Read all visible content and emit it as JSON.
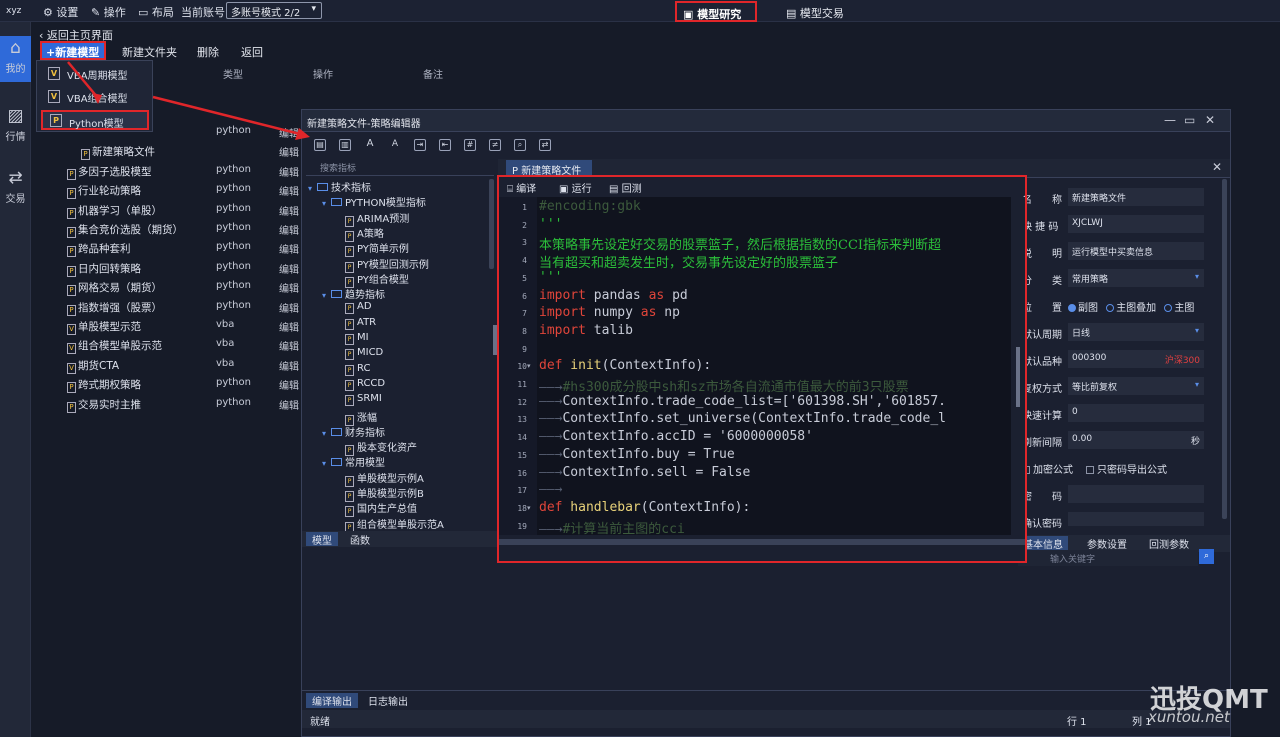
{
  "topbar": {
    "logo": "xyz",
    "settings": "设置",
    "operate": "操作",
    "layout": "布局",
    "account_label": "当前账号",
    "mode_select": "多账号模式 2/2",
    "research": "模型研究",
    "trade": "模型交易"
  },
  "rail": {
    "my": "我的",
    "market": "行情",
    "trade": "交易"
  },
  "main": {
    "back": "返回主页界面",
    "new_model": "新建模型",
    "new_folder": "新建文件夹",
    "delete": "删除",
    "back_btn": "返回",
    "col_type": "类型",
    "col_op": "操作",
    "col_note": "备注"
  },
  "dropdown": {
    "items": [
      "VBA周期模型",
      "VBA组合模型",
      "Python模型"
    ]
  },
  "list": [
    {
      "name": "新建策略文件",
      "type": "python",
      "op": "编辑"
    },
    {
      "name": "新建策略文件",
      "type": "",
      "op": "编辑"
    },
    {
      "name": "多因子选股模型",
      "type": "python",
      "op": "编辑"
    },
    {
      "name": "行业轮动策略",
      "type": "python",
      "op": "编辑"
    },
    {
      "name": "机器学习（单股）",
      "type": "python",
      "op": "编辑"
    },
    {
      "name": "集合竞价选股（期货）",
      "type": "python",
      "op": "编辑"
    },
    {
      "name": "跨品种套利",
      "type": "python",
      "op": "编辑"
    },
    {
      "name": "日内回转策略",
      "type": "python",
      "op": "编辑"
    },
    {
      "name": "网格交易（期货）",
      "type": "python",
      "op": "编辑"
    },
    {
      "name": "指数增强（股票）",
      "type": "python",
      "op": "编辑"
    },
    {
      "name": "单股模型示范",
      "type": "vba",
      "op": "编辑"
    },
    {
      "name": "组合模型单股示范",
      "type": "vba",
      "op": "编辑"
    },
    {
      "name": "期货CTA",
      "type": "vba",
      "op": "编辑"
    },
    {
      "name": "跨式期权策略",
      "type": "python",
      "op": "编辑"
    },
    {
      "name": "交易实时主推",
      "type": "python",
      "op": "编辑"
    }
  ],
  "editor": {
    "title": "新建策略文件-策略编辑器",
    "tree_search": "搜索指标",
    "tree": [
      {
        "level": 0,
        "kind": "folder",
        "label": "技术指标"
      },
      {
        "level": 1,
        "kind": "folder",
        "label": "PYTHON模型指标"
      },
      {
        "level": 2,
        "kind": "file",
        "label": "ARIMA预测"
      },
      {
        "level": 2,
        "kind": "file",
        "label": "A策略"
      },
      {
        "level": 2,
        "kind": "file",
        "label": "PY简单示例"
      },
      {
        "level": 2,
        "kind": "file",
        "label": "PY模型回测示例"
      },
      {
        "level": 2,
        "kind": "file",
        "label": "PY组合模型"
      },
      {
        "level": 1,
        "kind": "folder",
        "label": "趋势指标"
      },
      {
        "level": 2,
        "kind": "file",
        "label": "AD"
      },
      {
        "level": 2,
        "kind": "file",
        "label": "ATR"
      },
      {
        "level": 2,
        "kind": "file",
        "label": "MI"
      },
      {
        "level": 2,
        "kind": "file",
        "label": "MICD"
      },
      {
        "level": 2,
        "kind": "file",
        "label": "RC"
      },
      {
        "level": 2,
        "kind": "file",
        "label": "RCCD"
      },
      {
        "level": 2,
        "kind": "file",
        "label": "SRMI"
      },
      {
        "level": 2,
        "kind": "file",
        "label": "涨幅"
      },
      {
        "level": 1,
        "kind": "folder",
        "label": "财务指标"
      },
      {
        "level": 2,
        "kind": "file",
        "label": "股本变化资产"
      },
      {
        "level": 1,
        "kind": "folder",
        "label": "常用模型"
      },
      {
        "level": 2,
        "kind": "file",
        "label": "单股模型示例A"
      },
      {
        "level": 2,
        "kind": "file",
        "label": "单股模型示例B"
      },
      {
        "level": 2,
        "kind": "file",
        "label": "国内生产总值"
      },
      {
        "level": 2,
        "kind": "file",
        "label": "组合模型单股示范A"
      }
    ],
    "left_tabs": [
      "模型",
      "函数"
    ],
    "file_tab": "新建策略文件",
    "code_bar": {
      "compile": "编译",
      "run": "运行",
      "backtest": "回测"
    },
    "code": [
      {
        "n": "1",
        "fold": false,
        "parts": [
          {
            "c": "cm",
            "t": "#encoding:gbk"
          }
        ]
      },
      {
        "n": "2",
        "fold": false,
        "parts": [
          {
            "c": "st",
            "t": "'''"
          }
        ]
      },
      {
        "n": "3",
        "fold": false,
        "parts": [
          {
            "c": "zh",
            "t": "本策略事先设定好交易的股票篮子，然后根据指数的CCI指标来判断超"
          }
        ]
      },
      {
        "n": "4",
        "fold": false,
        "parts": [
          {
            "c": "zh",
            "t": "当有超买和超卖发生时，交易事先设定好的股票篮子"
          }
        ]
      },
      {
        "n": "5",
        "fold": false,
        "parts": [
          {
            "c": "st",
            "t": "'''"
          }
        ]
      },
      {
        "n": "6",
        "fold": false,
        "parts": [
          {
            "c": "kw",
            "t": "import"
          },
          {
            "c": "nm",
            "t": " pandas "
          },
          {
            "c": "kw",
            "t": "as"
          },
          {
            "c": "nm",
            "t": " pd"
          }
        ]
      },
      {
        "n": "7",
        "fold": false,
        "parts": [
          {
            "c": "kw",
            "t": "import"
          },
          {
            "c": "nm",
            "t": " numpy "
          },
          {
            "c": "kw",
            "t": "as"
          },
          {
            "c": "nm",
            "t": " np"
          }
        ]
      },
      {
        "n": "8",
        "fold": false,
        "parts": [
          {
            "c": "kw",
            "t": "import"
          },
          {
            "c": "nm",
            "t": " talib"
          }
        ]
      },
      {
        "n": "9",
        "fold": false,
        "parts": []
      },
      {
        "n": "10",
        "fold": true,
        "parts": [
          {
            "c": "kw",
            "t": "def"
          },
          {
            "c": "fn",
            "t": " init"
          },
          {
            "c": "nm",
            "t": "(ContextInfo):"
          }
        ]
      },
      {
        "n": "11",
        "fold": false,
        "parts": [
          {
            "c": "ar2",
            "t": "——→"
          },
          {
            "c": "cm",
            "t": "#hs300成分股中sh和sz市场各自流通市值最大的前3只股票"
          }
        ]
      },
      {
        "n": "12",
        "fold": false,
        "parts": [
          {
            "c": "ar2",
            "t": "——→"
          },
          {
            "c": "nm",
            "t": "ContextInfo.trade_code_list=['601398.SH','601857."
          }
        ]
      },
      {
        "n": "13",
        "fold": false,
        "parts": [
          {
            "c": "ar2",
            "t": "——→"
          },
          {
            "c": "nm",
            "t": "ContextInfo.set_universe(ContextInfo.trade_code_l"
          }
        ]
      },
      {
        "n": "14",
        "fold": false,
        "parts": [
          {
            "c": "ar2",
            "t": "——→"
          },
          {
            "c": "nm",
            "t": "ContextInfo.accID = '6000000058'"
          }
        ]
      },
      {
        "n": "15",
        "fold": false,
        "parts": [
          {
            "c": "ar2",
            "t": "——→"
          },
          {
            "c": "nm",
            "t": "ContextInfo.buy = True"
          }
        ]
      },
      {
        "n": "16",
        "fold": false,
        "parts": [
          {
            "c": "ar2",
            "t": "——→"
          },
          {
            "c": "nm",
            "t": "ContextInfo.sell = False"
          }
        ]
      },
      {
        "n": "17",
        "fold": false,
        "parts": [
          {
            "c": "ar2",
            "t": "——→"
          }
        ]
      },
      {
        "n": "18",
        "fold": true,
        "parts": [
          {
            "c": "kw",
            "t": "def"
          },
          {
            "c": "fn",
            "t": " handlebar"
          },
          {
            "c": "nm",
            "t": "(ContextInfo):"
          }
        ]
      },
      {
        "n": "19",
        "fold": false,
        "parts": [
          {
            "c": "ar2",
            "t": "——→"
          },
          {
            "c": "cm",
            "t": "#计算当前主图的cci"
          }
        ]
      }
    ],
    "props": {
      "name_label": "名　　称",
      "name_value": "新建策略文件",
      "abbr_label": "快 捷 码",
      "abbr_value": "XJCLWJ",
      "desc_label": "说　　明",
      "desc_value": "运行模型中买卖信息",
      "cat_label": "分　　类",
      "cat_value": "常用策略",
      "pos_label": "位　　置",
      "pos_options": [
        "副图",
        "主图叠加",
        "主图"
      ],
      "period_label": "默认周期",
      "period_value": "日线",
      "stock_label": "默认品种",
      "stock_value": "000300",
      "stock_tag": "沪深300",
      "adj_label": "复权方式",
      "adj_value": "等比前复权",
      "calc_label": "快速计算",
      "calc_value": "0",
      "refresh_label": "刷新间隔",
      "refresh_value": "0.00",
      "refresh_unit": "秒",
      "encrypt_label": "加密公式",
      "export_label": "只密码导出公式",
      "pwd_label": "密　　码",
      "pwd_confirm_label": "确认密码"
    },
    "prop_tabs": [
      "基本信息",
      "参数设置",
      "回测参数"
    ],
    "keyword_placeholder": "输入关键字",
    "out_tabs": [
      "编译输出",
      "日志输出"
    ],
    "status": {
      "left": "就绪",
      "line": "行 1",
      "col": "列 1"
    }
  },
  "watermark": {
    "brand": "迅投QMT",
    "site": "xuntou.net"
  }
}
